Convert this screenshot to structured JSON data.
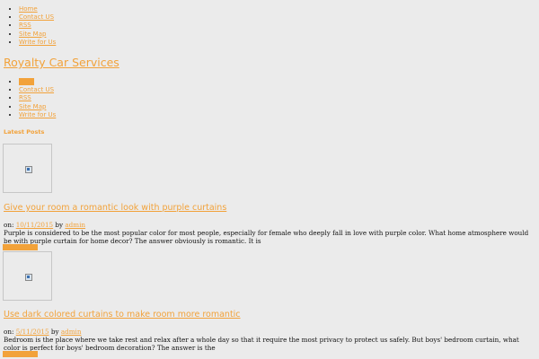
{
  "top_nav": [
    "Home",
    "Contact US",
    "RSS",
    "Site Map",
    "Write for Us"
  ],
  "site_title": "Royalty Car Services",
  "main_nav": [
    "",
    "Contact US",
    "RSS",
    "Site Map",
    "Write for Us"
  ],
  "latest_posts_heading": "Latest Posts",
  "posts": [
    {
      "title": "Give your room a romantic look with purple curtains",
      "meta_on": "on:",
      "date": "10/11/2015",
      "meta_by": "by",
      "author": "admin",
      "excerpt": "Purple is considered to be the most popular color for most people, especially for female who deeply fall in love with purple color. What home atmosphere would be with purple curtain for home decor? The answer obviously is romantic. It is"
    },
    {
      "title": "Use dark colored curtains to make room more romantic",
      "meta_on": "on:",
      "date": "5/11/2015",
      "meta_by": "by",
      "author": "admin",
      "excerpt": "Bedroom is the place where we take rest and relax after a whole day so that it require the most privacy to protect us safely. But boys' bedroom curtain, what color is perfect for boys' bedroom decoration? The answer is the"
    }
  ],
  "colors": {
    "accent": "#f2a23a",
    "background": "#ebebeb",
    "text": "#111111"
  }
}
